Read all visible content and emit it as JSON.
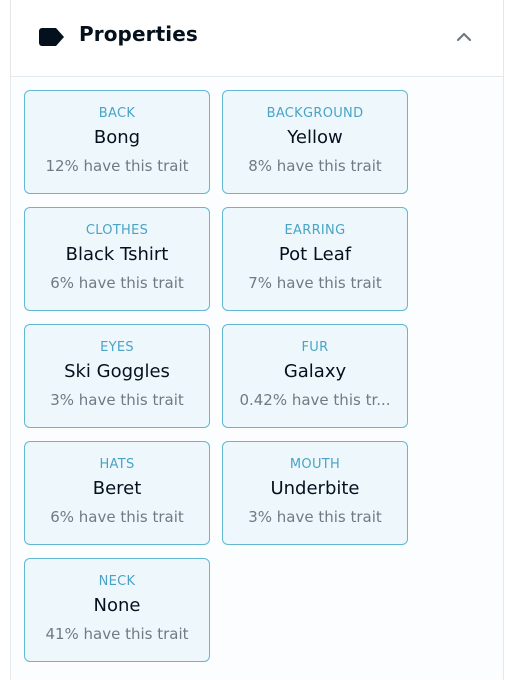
{
  "header": {
    "title": "Properties",
    "icon": "tag-icon",
    "toggle_icon": "chevron-up-icon"
  },
  "colors": {
    "card_border": "#62b8d0",
    "card_background": "#eef8fc",
    "trait_type": "#4aa3c7",
    "trait_value": "#04111d",
    "rarity_text": "#707a83"
  },
  "traits": [
    {
      "type": "BACK",
      "value": "Bong",
      "rarity": "12% have this trait"
    },
    {
      "type": "BACKGROUND",
      "value": "Yellow",
      "rarity": "8% have this trait"
    },
    {
      "type": "CLOTHES",
      "value": "Black Tshirt",
      "rarity": "6% have this trait"
    },
    {
      "type": "EARRING",
      "value": "Pot Leaf",
      "rarity": "7% have this trait"
    },
    {
      "type": "EYES",
      "value": "Ski Goggles",
      "rarity": "3% have this trait"
    },
    {
      "type": "FUR",
      "value": "Galaxy",
      "rarity": "0.42% have this tr..."
    },
    {
      "type": "HATS",
      "value": "Beret",
      "rarity": "6% have this trait"
    },
    {
      "type": "MOUTH",
      "value": "Underbite",
      "rarity": "3% have this trait"
    },
    {
      "type": "NECK",
      "value": "None",
      "rarity": "41% have this trait"
    }
  ]
}
